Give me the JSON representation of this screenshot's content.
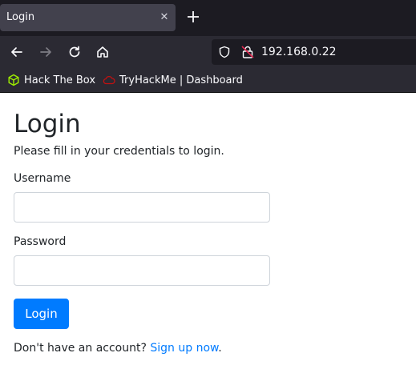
{
  "browser": {
    "tab": {
      "title": "Login",
      "close_glyph": "✕"
    },
    "new_tab_icon": "plus-icon",
    "nav": {
      "back_icon": "arrow-left-icon",
      "forward_icon": "arrow-right-icon",
      "reload_icon": "reload-icon",
      "home_icon": "home-icon"
    },
    "url": "192.168.0.22",
    "bookmarks": [
      {
        "label": "Hack The Box",
        "icon": "cube-icon",
        "color": "#9fef00"
      },
      {
        "label": "TryHackMe | Dashboard",
        "icon": "cloud-icon",
        "color": "#c11111"
      }
    ],
    "colors": {
      "tabbar": "#1c1b22",
      "toolbar": "#2b2a33",
      "tab": "#42414d"
    }
  },
  "page": {
    "title": "Login",
    "subtitle": "Please fill in your credentials to login.",
    "username": {
      "label": "Username",
      "value": "",
      "placeholder": ""
    },
    "password": {
      "label": "Password",
      "value": "",
      "placeholder": ""
    },
    "submit_label": "Login",
    "signup": {
      "prefix": "Don't have an account?",
      "link_text": "Sign up now",
      "suffix": "."
    },
    "colors": {
      "primary": "#007bff",
      "text": "#212529",
      "input_border": "#ced4da"
    }
  }
}
